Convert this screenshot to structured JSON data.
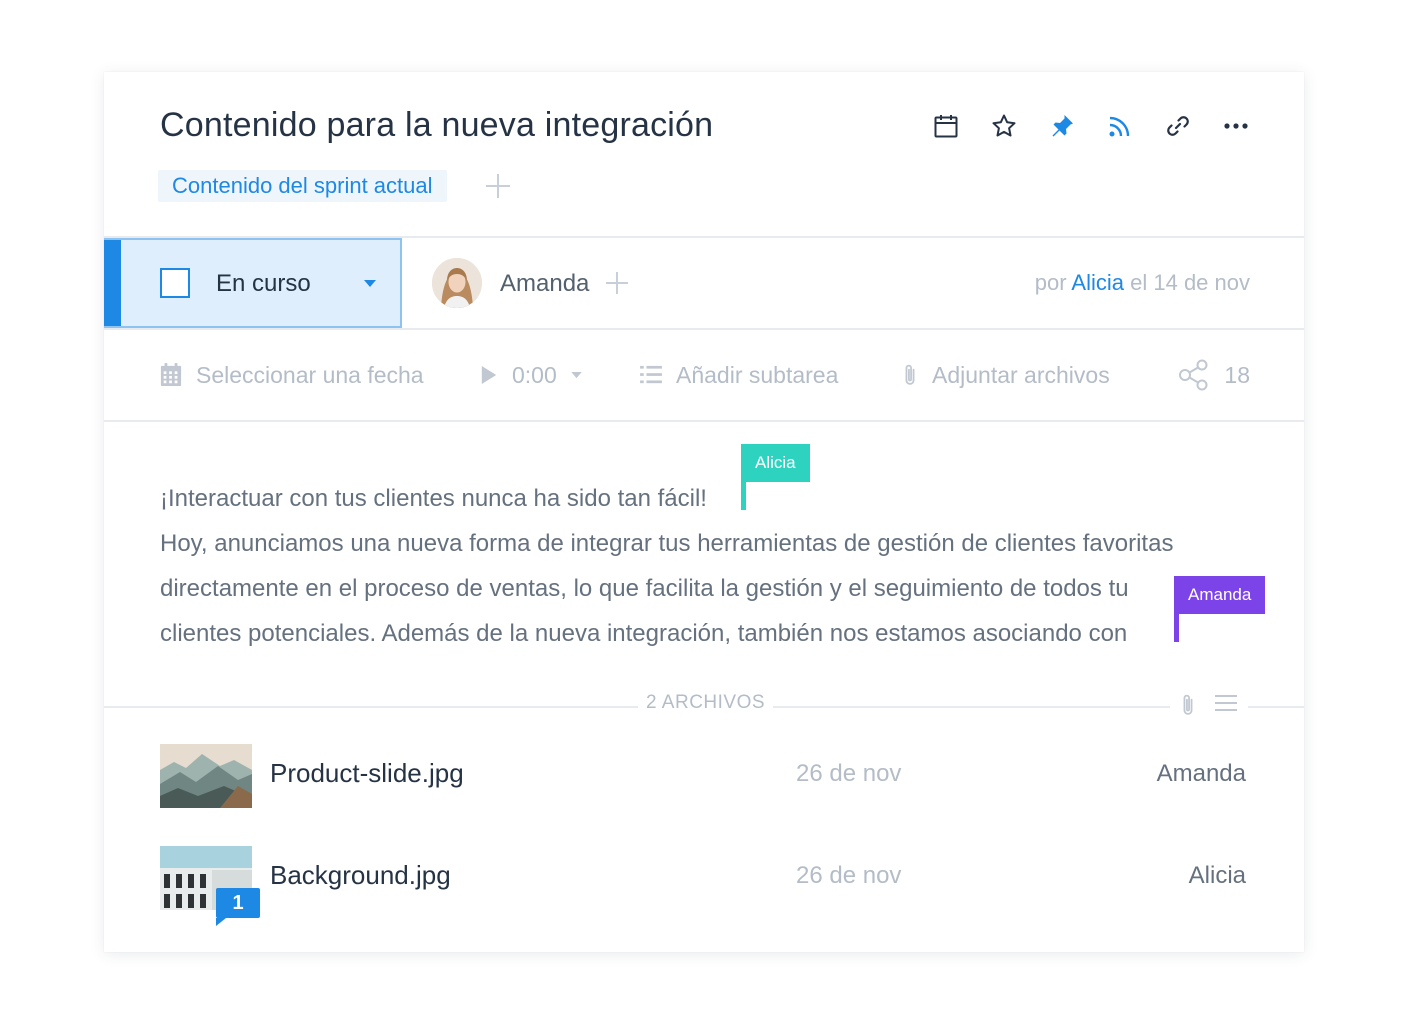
{
  "task": {
    "title": "Contenido para la nueva integración",
    "tag": "Contenido del sprint actual"
  },
  "header_icons": [
    "calendar-icon",
    "star-icon",
    "pin-icon",
    "rss-icon",
    "link-icon",
    "more-icon"
  ],
  "colors": {
    "accent": "#1e88e5",
    "alicia_cursor": "#2ed3c0",
    "amanda_cursor": "#7c43e8",
    "text_dark": "#253345",
    "text_muted": "#b3bcc7"
  },
  "status": {
    "label": "En curso"
  },
  "assignee": {
    "name": "Amanda"
  },
  "byline": {
    "prefix": "por",
    "author": "Alicia",
    "date": "el 14 de nov"
  },
  "toolbar": {
    "date_label": "Seleccionar una fecha",
    "time_value": "0:00",
    "subtask_label": "Añadir subtarea",
    "attach_label": "Adjuntar archivos",
    "share_count": "18"
  },
  "description": {
    "line1": "¡Interactuar con tus clientes nunca ha sido tan fácil!",
    "line2": "Hoy, anunciamos una nueva forma de integrar tus herramientas de gestión de clientes favoritas",
    "line3": "directamente en el proceso de ventas, lo que facilita la gestión y el seguimiento de todos tu",
    "line4": "clientes potenciales. Además de la nueva integración, también nos estamos asociando con"
  },
  "cursors": [
    {
      "user": "Alicia"
    },
    {
      "user": "Amanda"
    }
  ],
  "files": {
    "header": "2 ARCHIVOS",
    "items": [
      {
        "name": "Product-slide.jpg",
        "date": "26 de nov",
        "user": "Amanda"
      },
      {
        "name": "Background.jpg",
        "date": "26 de nov",
        "user": "Alicia",
        "comments": "1"
      }
    ]
  }
}
